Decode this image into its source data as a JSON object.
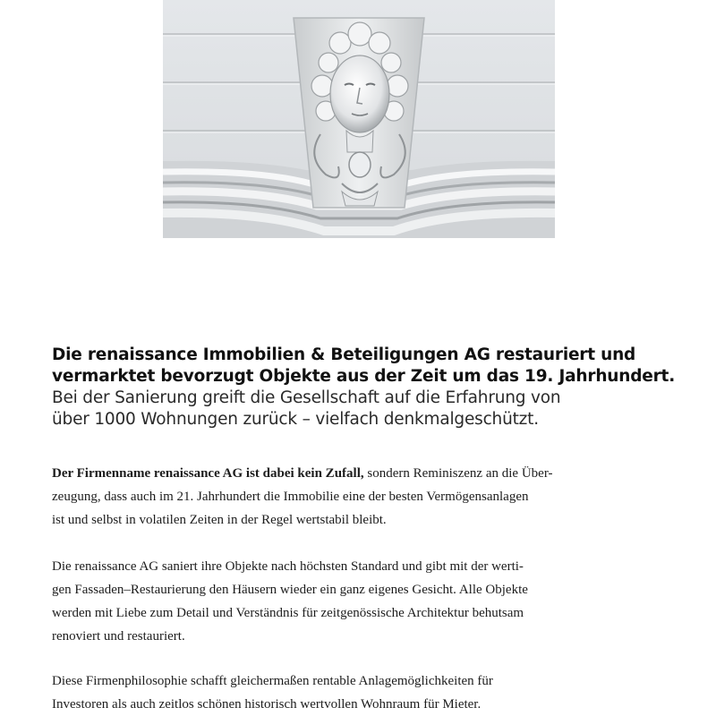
{
  "image": {
    "alt_subject": "relief-face-ornament"
  },
  "intro": {
    "bold_lines": [
      "Die renaissance Immobilien & Beteiligungen AG restauriert und",
      "vermarktet bevorzugt Objekte aus der Zeit um das 19. Jahrhundert."
    ],
    "light_lines": [
      "Bei der Sanierung greift die Gesellschaft auf die Erfahrung von",
      "über 1000 Wohnungen zurück – vielfach denkmalgeschützt."
    ]
  },
  "paragraphs": {
    "p1": {
      "bold_start": "Der Firmenname renaissance AG ist dabei kein Zufall,",
      "line1_rest": " sondern Reminiszenz an die Über-",
      "line2": "zeugung, dass auch im 21. Jahrhundert die Immobilie eine der besten Vermögensanlagen",
      "line3": "ist und selbst in volatilen Zeiten in der Regel wertstabil bleibt."
    },
    "p2": {
      "line1": "Die renaissance AG saniert ihre Objekte nach höchsten Standard und gibt mit der werti-",
      "line2": "gen Fassaden–Restaurierung den Häusern wieder ein ganz eigenes Gesicht. Alle Objekte",
      "line3": "werden mit Liebe zum Detail und Verständnis für zeitgenössische Architektur behutsam",
      "line4": "renoviert und restauriert."
    },
    "p3": {
      "line1": "Diese Firmenphilosophie schafft gleichermaßen rentable Anlagemöglichkeiten für",
      "line2": "Investoren als auch zeitlos schönen historisch wertvollen Wohnraum für Mieter."
    }
  }
}
